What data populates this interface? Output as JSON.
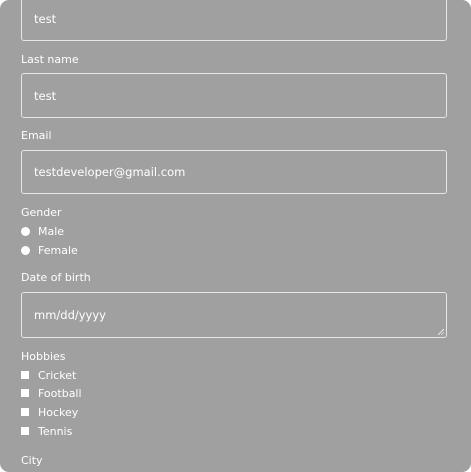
{
  "form": {
    "first_name": {
      "value": "test"
    },
    "last_name": {
      "label": "Last name",
      "value": "test"
    },
    "email": {
      "label": "Email",
      "value": "testdeveloper@gmail.com"
    },
    "gender": {
      "label": "Gender",
      "options": [
        "Male",
        "Female"
      ]
    },
    "dob": {
      "label": "Date of birth",
      "placeholder": "mm/dd/yyyy"
    },
    "hobbies": {
      "label": "Hobbies",
      "options": [
        "Cricket",
        "Football",
        "Hockey",
        "Tennis"
      ]
    },
    "city": {
      "label": "City"
    }
  },
  "colors": {
    "panel_bg": "#a0a0a0",
    "text": "#ffffff",
    "border": "#e6e6e6"
  }
}
